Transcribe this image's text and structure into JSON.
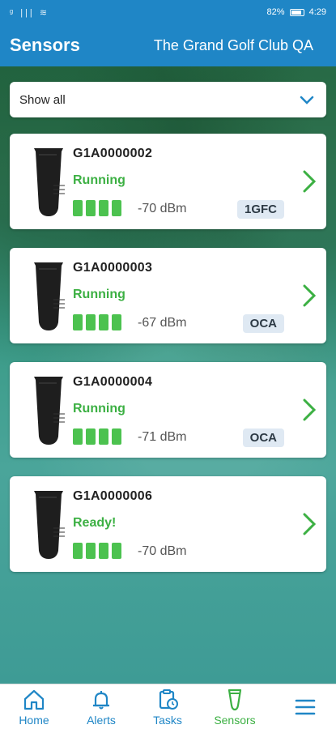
{
  "status_bar": {
    "left": "ᵍ ||| ≋",
    "battery": "82%",
    "time": "4:29"
  },
  "header": {
    "title": "Sensors",
    "club": "The Grand Golf Club QA"
  },
  "filter": {
    "selected": "Show all"
  },
  "sensors": [
    {
      "id": "G1A0000002",
      "status": "Running",
      "signal_bars": 4,
      "dbm": "-70 dBm",
      "badge": "1GFC"
    },
    {
      "id": "G1A0000003",
      "status": "Running",
      "signal_bars": 4,
      "dbm": "-67 dBm",
      "badge": "OCA"
    },
    {
      "id": "G1A0000004",
      "status": "Running",
      "signal_bars": 4,
      "dbm": "-71 dBm",
      "badge": "OCA"
    },
    {
      "id": "G1A0000006",
      "status": "Ready!",
      "signal_bars": 4,
      "dbm": "-70 dBm",
      "badge": ""
    }
  ],
  "nav": {
    "home": "Home",
    "alerts": "Alerts",
    "tasks": "Tasks",
    "sensors": "Sensors"
  },
  "colors": {
    "primary": "#1f86c6",
    "success": "#3cb043",
    "signal": "#4cc24f"
  }
}
